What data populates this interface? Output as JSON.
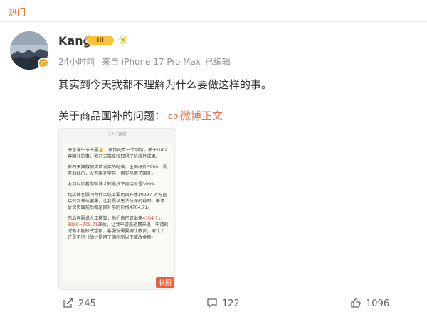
{
  "header": {
    "section_label": "热门"
  },
  "post": {
    "author": "Kang",
    "vip_level": "III",
    "meta": {
      "time": "24小时前",
      "source": "来自 iPhone 17 Pro Max",
      "edited": "已编辑"
    },
    "text": "其实到今天我都不理解为什么要做这样的事。",
    "question_prefix": "关于商品国补的问题：",
    "weibo_link_label": "微博正文",
    "image": {
      "header": "17分钟前",
      "paragraphs": [
        "康总端午节牛逼👍，跟你同步一个事情，关于Luna客国补的事，我在天猫维权取得了阶段性成果。",
        "影石天猫旗舰店首发买的时候，主图标价3999，没有划线价，没有国补字样，但实际用了国补。",
        "收到以后看你微博才知道线下直接就是3999。",
        "找店铺客服问为什么线上要用国补才3999？对方直接转到差价客服，让我提供无法价保的截图，申请价保页面前后都是国补前的价格4704.71。",
        "然后客服说人工核算，他们自己算出来4704.71-3999=705.71差价，让我申请退运费来退，申请的时候不能修改金额，客服说需要确认收货，确认了还是不行（估计是用了国补所以不能改金额）"
      ],
      "long_image_tag": "长图"
    },
    "actions": {
      "shares": "245",
      "comments": "122",
      "likes": "1096"
    }
  },
  "colors": {
    "accent": "#eb7350",
    "section": "#e86a25",
    "meta": "#939393"
  },
  "icons": [
    "share-icon",
    "comment-icon",
    "like-icon",
    "link-icon",
    "sun-icon",
    "vip-crown-icon",
    "verified-badge-icon"
  ]
}
